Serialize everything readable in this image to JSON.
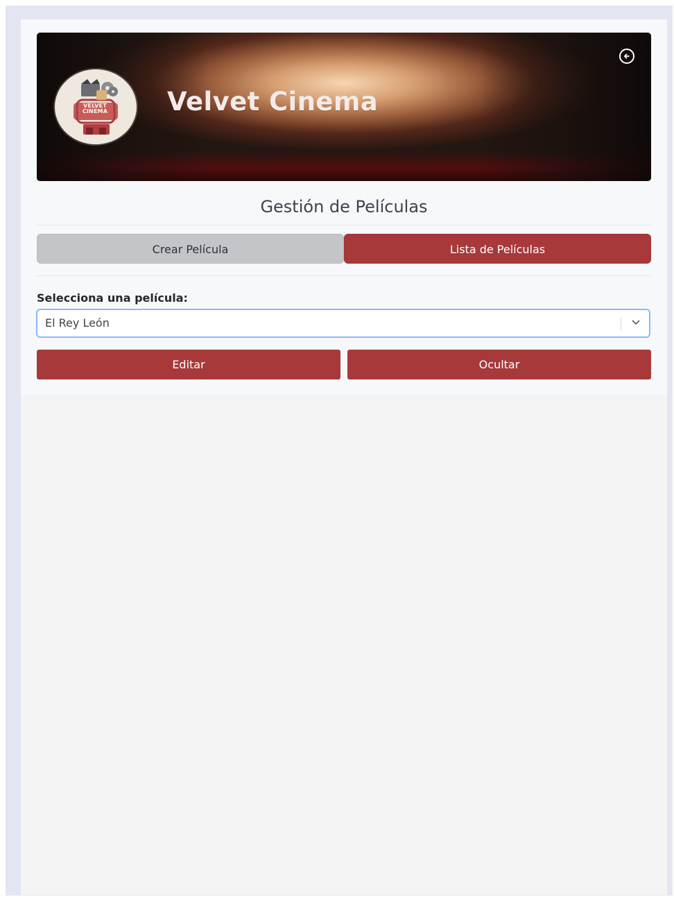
{
  "brand": {
    "name": "Velvet Cinema",
    "logo_text": "VELVET CINEMA"
  },
  "page": {
    "title": "Gestión de Películas"
  },
  "tabs": {
    "create": "Crear Película",
    "list": "Lista de Películas"
  },
  "movie_select": {
    "label": "Selecciona una película:",
    "value": "El Rey León"
  },
  "actions": {
    "edit": "Editar",
    "hide": "Ocultar"
  },
  "colors": {
    "accent": "#a8393a",
    "tab_inactive": "#c3c5c8",
    "focus_ring": "#8bb9f7"
  },
  "icons": {
    "back": "back-circle-icon",
    "dropdown": "chevron-down-icon"
  }
}
